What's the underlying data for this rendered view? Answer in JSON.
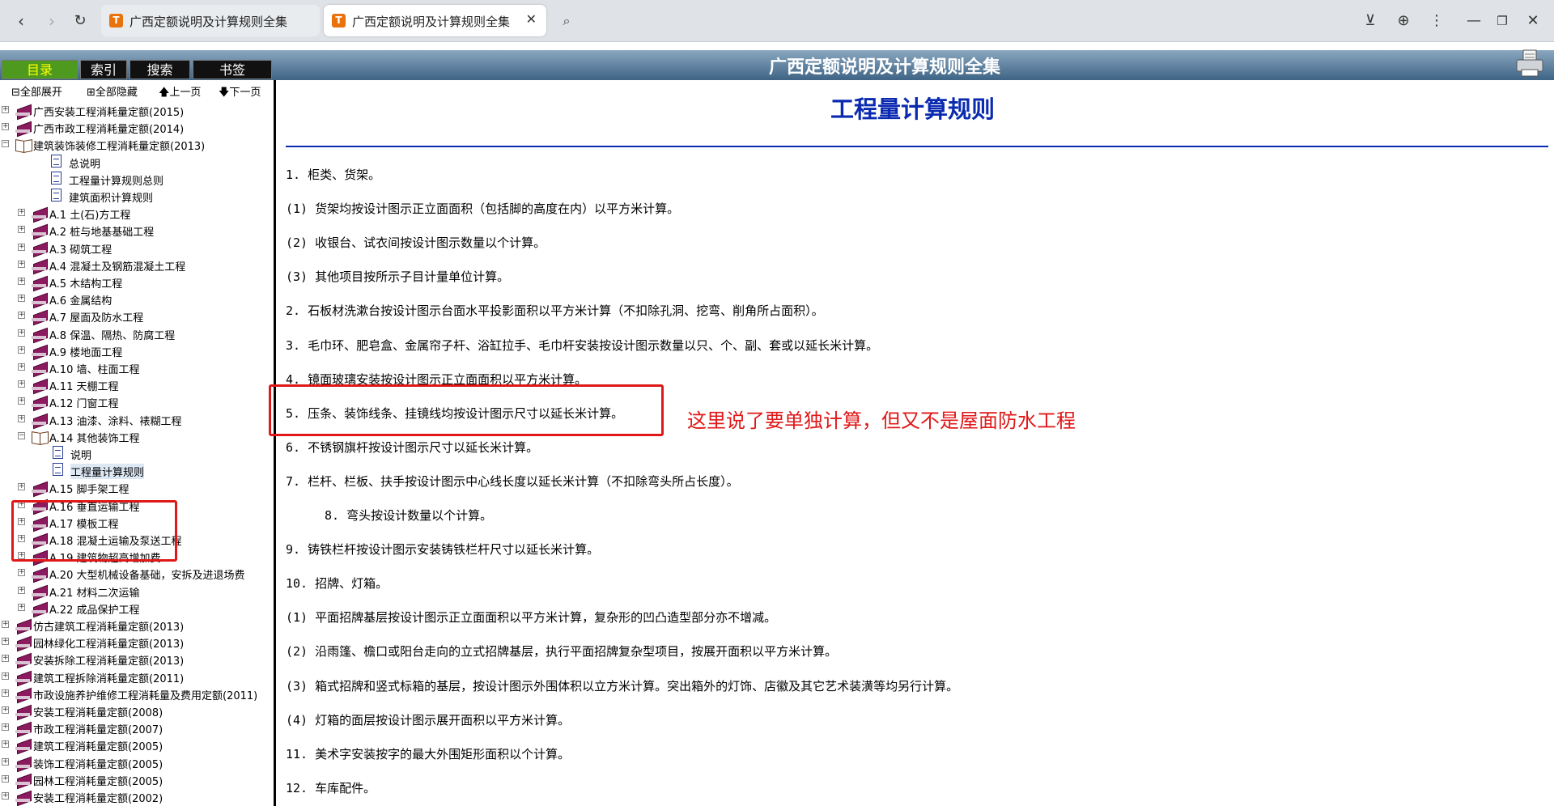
{
  "browser": {
    "tabs": [
      {
        "title": "广西定额说明及计算规则全集",
        "active": false
      },
      {
        "title": "广西定额说明及计算规则全集",
        "active": true
      }
    ],
    "close_glyph": "✕"
  },
  "app": {
    "title": "广西定额说明及计算规则全集",
    "nav_tabs": [
      "目录",
      "索引",
      "搜索",
      "书签"
    ],
    "toolbar": [
      "⊟全部展开",
      "⊞全部隐藏",
      "🡅上一页",
      "🡇下一页"
    ]
  },
  "tree": [
    {
      "level": 0,
      "icon": "book",
      "exp": "+",
      "label": "广西安装工程消耗量定额(2015)"
    },
    {
      "level": 0,
      "icon": "book",
      "exp": "+",
      "label": "广西市政工程消耗量定额(2014)"
    },
    {
      "level": 0,
      "icon": "openbook",
      "exp": "-",
      "label": "建筑装饰装修工程消耗量定额(2013)"
    },
    {
      "level": 1,
      "icon": "doc",
      "exp": "",
      "label": "总说明"
    },
    {
      "level": 1,
      "icon": "doc",
      "exp": "",
      "label": "工程量计算规则总则"
    },
    {
      "level": 1,
      "icon": "doc",
      "exp": "",
      "label": "建筑面积计算规则"
    },
    {
      "level": 1,
      "icon": "book",
      "exp": "+",
      "label": "A.1 土(石)方工程"
    },
    {
      "level": 1,
      "icon": "book",
      "exp": "+",
      "label": "A.2 桩与地基基础工程"
    },
    {
      "level": 1,
      "icon": "book",
      "exp": "+",
      "label": "A.3 砌筑工程"
    },
    {
      "level": 1,
      "icon": "book",
      "exp": "+",
      "label": "A.4 混凝土及钢筋混凝土工程"
    },
    {
      "level": 1,
      "icon": "book",
      "exp": "+",
      "label": "A.5 木结构工程"
    },
    {
      "level": 1,
      "icon": "book",
      "exp": "+",
      "label": "A.6 金属结构"
    },
    {
      "level": 1,
      "icon": "book",
      "exp": "+",
      "label": "A.7 屋面及防水工程"
    },
    {
      "level": 1,
      "icon": "book",
      "exp": "+",
      "label": "A.8 保温、隔热、防腐工程"
    },
    {
      "level": 1,
      "icon": "book",
      "exp": "+",
      "label": "A.9 楼地面工程"
    },
    {
      "level": 1,
      "icon": "book",
      "exp": "+",
      "label": "A.10 墙、柱面工程"
    },
    {
      "level": 1,
      "icon": "book",
      "exp": "+",
      "label": "A.11 天棚工程"
    },
    {
      "level": 1,
      "icon": "book",
      "exp": "+",
      "label": "A.12 门窗工程"
    },
    {
      "level": 1,
      "icon": "book",
      "exp": "+",
      "label": "A.13 油漆、涂料、裱糊工程"
    },
    {
      "level": 1,
      "icon": "openbook",
      "exp": "-",
      "label": "A.14 其他装饰工程"
    },
    {
      "level": 2,
      "icon": "doc",
      "exp": "",
      "label": "说明"
    },
    {
      "level": 2,
      "icon": "doc",
      "exp": "",
      "label": "工程量计算规则",
      "selected": true
    },
    {
      "level": 1,
      "icon": "book",
      "exp": "+",
      "label": "A.15 脚手架工程"
    },
    {
      "level": 1,
      "icon": "book",
      "exp": "+",
      "label": "A.16 垂直运输工程"
    },
    {
      "level": 1,
      "icon": "book",
      "exp": "+",
      "label": "A.17 模板工程"
    },
    {
      "level": 1,
      "icon": "book",
      "exp": "+",
      "label": "A.18 混凝土运输及泵送工程"
    },
    {
      "level": 1,
      "icon": "book",
      "exp": "+",
      "label": "A.19 建筑物超高增加费"
    },
    {
      "level": 1,
      "icon": "book",
      "exp": "+",
      "label": "A.20 大型机械设备基础，安拆及进退场费"
    },
    {
      "level": 1,
      "icon": "book",
      "exp": "+",
      "label": "A.21 材料二次运输"
    },
    {
      "level": 1,
      "icon": "book",
      "exp": "+",
      "label": "A.22 成品保护工程"
    },
    {
      "level": 0,
      "icon": "book",
      "exp": "+",
      "label": "仿古建筑工程消耗量定额(2013)"
    },
    {
      "level": 0,
      "icon": "book",
      "exp": "+",
      "label": "园林绿化工程消耗量定额(2013)"
    },
    {
      "level": 0,
      "icon": "book",
      "exp": "+",
      "label": "安装拆除工程消耗量定额(2013)"
    },
    {
      "level": 0,
      "icon": "book",
      "exp": "+",
      "label": "建筑工程拆除消耗量定额(2011)"
    },
    {
      "level": 0,
      "icon": "book",
      "exp": "+",
      "label": "市政设施养护维修工程消耗量及费用定额(2011)"
    },
    {
      "level": 0,
      "icon": "book",
      "exp": "+",
      "label": "安装工程消耗量定额(2008)"
    },
    {
      "level": 0,
      "icon": "book",
      "exp": "+",
      "label": "市政工程消耗量定额(2007)"
    },
    {
      "level": 0,
      "icon": "book",
      "exp": "+",
      "label": "建筑工程消耗量定额(2005)"
    },
    {
      "level": 0,
      "icon": "book",
      "exp": "+",
      "label": "装饰工程消耗量定额(2005)"
    },
    {
      "level": 0,
      "icon": "book",
      "exp": "+",
      "label": "园林工程消耗量定额(2005)"
    },
    {
      "level": 0,
      "icon": "book",
      "exp": "+",
      "label": "安装工程消耗量定额(2002)"
    }
  ],
  "content": {
    "title": "工程量计算规则",
    "lines": [
      {
        "text": "1. 柜类、货架。",
        "indent": 0
      },
      {
        "text": "(1) 货架均按设计图示正立面面积（包括脚的高度在内）以平方米计算。",
        "indent": 0
      },
      {
        "text": "(2) 收银台、试衣间按设计图示数量以个计算。",
        "indent": 0
      },
      {
        "text": "(3) 其他项目按所示子目计量单位计算。",
        "indent": 0
      },
      {
        "text": "2. 石板材洗漱台按设计图示台面水平投影面积以平方米计算（不扣除孔洞、挖弯、削角所占面积）。",
        "indent": 0
      },
      {
        "text": "3. 毛巾环、肥皂盒、金属帘子杆、浴缸拉手、毛巾杆安装按设计图示数量以只、个、副、套或以延长米计算。",
        "indent": 0
      },
      {
        "text": "4. 镜面玻璃安装按设计图示正立面面积以平方米计算。",
        "indent": 0
      },
      {
        "text": "5. 压条、装饰线条、挂镜线均按设计图示尺寸以延长米计算。",
        "indent": 0
      },
      {
        "text": "6. 不锈钢旗杆按设计图示尺寸以延长米计算。",
        "indent": 0
      },
      {
        "text": "7. 栏杆、栏板、扶手按设计图示中心线长度以延长米计算（不扣除弯头所占长度）。",
        "indent": 0
      },
      {
        "text": "8. 弯头按设计数量以个计算。",
        "indent": 1
      },
      {
        "text": "9. 铸铁栏杆按设计图示安装铸铁栏杆尺寸以延长米计算。",
        "indent": 0
      },
      {
        "text": "10. 招牌、灯箱。",
        "indent": 0
      },
      {
        "text": "(1) 平面招牌基层按设计图示正立面面积以平方米计算，复杂形的凹凸造型部分亦不增减。",
        "indent": 0
      },
      {
        "text": "(2) 沿雨篷、檐口或阳台走向的立式招牌基层，执行平面招牌复杂型项目，按展开面积以平方米计算。",
        "indent": 0
      },
      {
        "text": "(3) 箱式招牌和竖式标箱的基层，按设计图示外围体积以立方米计算。突出箱外的灯饰、店徽及其它艺术装潢等均另行计算。",
        "indent": 0
      },
      {
        "text": "(4) 灯箱的面层按设计图示展开面积以平方米计算。",
        "indent": 0
      },
      {
        "text": "11. 美术字安装按字的最大外围矩形面积以个计算。",
        "indent": 0
      },
      {
        "text": "12. 车库配件。",
        "indent": 0
      }
    ],
    "annotation": "这里说了要单独计算，但又不是屋面防水工程"
  }
}
